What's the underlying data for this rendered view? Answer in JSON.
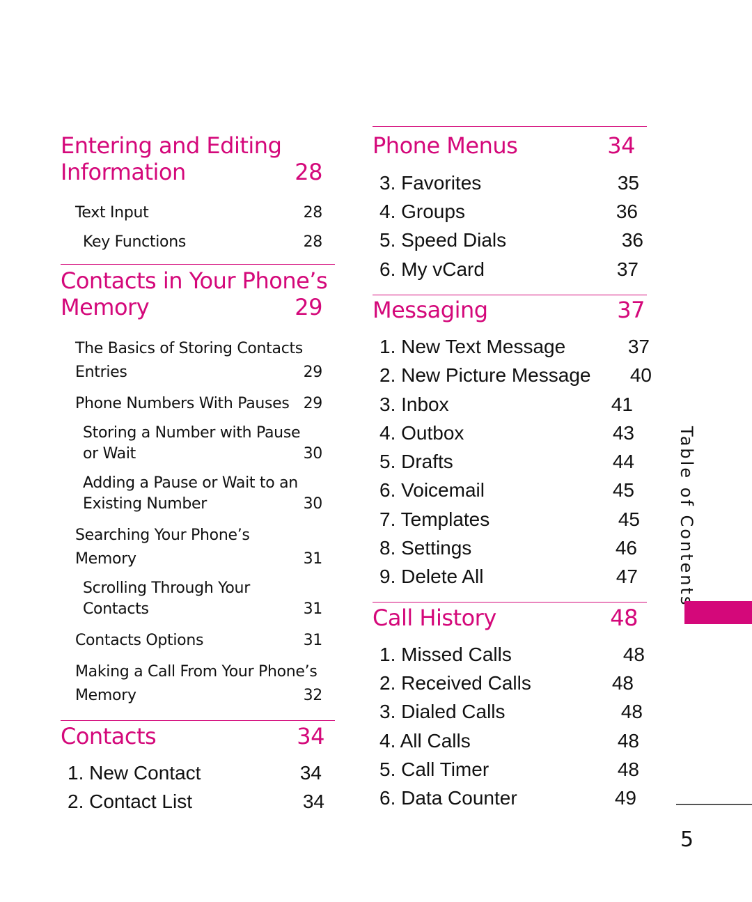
{
  "left_column": {
    "sections": [
      {
        "title_line1": "Entering and Editing",
        "title_line2": "Information",
        "page": "28",
        "entries": [
          {
            "text": "Text Input",
            "page": "28"
          },
          {
            "text": "Key Functions",
            "page": "28"
          }
        ]
      },
      {
        "title_line1": "Contacts in Your Phone’s",
        "title_line2": "Memory",
        "page": "29",
        "entries": [
          {
            "line1": "The Basics of Storing Contacts",
            "line2": "Entries",
            "page": "29"
          },
          {
            "text": "Phone Numbers With Pauses",
            "page": "29"
          },
          {
            "line1": "Storing a Number with Pause",
            "line2": "or Wait",
            "page": "30"
          },
          {
            "line1": "Adding a Pause or Wait to an",
            "line2": "Existing Number",
            "page": "30"
          },
          {
            "line1": "Searching Your Phone’s",
            "line2": "Memory",
            "page": "31"
          },
          {
            "line1": "Scrolling Through Your",
            "line2": "Contacts",
            "page": "31"
          },
          {
            "text": "Contacts Options",
            "page": "31"
          },
          {
            "line1": "Making a Call From Your Phone’s",
            "line2": "Memory",
            "page": "32"
          }
        ]
      },
      {
        "title": "Contacts",
        "page": "34",
        "entries": [
          {
            "text": "1. New Contact",
            "page": "34"
          },
          {
            "text": "2. Contact List",
            "page": "34"
          }
        ]
      }
    ]
  },
  "right_column": {
    "sections": [
      {
        "title": "Phone Menus",
        "page": "34",
        "entries": [
          {
            "text": "3. Favorites",
            "page": "35"
          },
          {
            "text": "4. Groups",
            "page": "36"
          },
          {
            "text": "5. Speed Dials",
            "page": "36"
          },
          {
            "text": "6. My vCard",
            "page": "37"
          }
        ]
      },
      {
        "title": "Messaging",
        "page": "37",
        "entries": [
          {
            "text": "1. New Text Message",
            "page": "37"
          },
          {
            "text": "2. New Picture Message",
            "page": "40"
          },
          {
            "text": "3. Inbox",
            "page": "41"
          },
          {
            "text": "4. Outbox",
            "page": "43"
          },
          {
            "text": "5. Drafts",
            "page": "44"
          },
          {
            "text": "6. Voicemail",
            "page": "45"
          },
          {
            "text": "7. Templates",
            "page": "45"
          },
          {
            "text": "8. Settings",
            "page": "46"
          },
          {
            "text": "9. Delete All",
            "page": "47"
          }
        ]
      },
      {
        "title": "Call History",
        "page": "48",
        "entries": [
          {
            "text": "1. Missed Calls",
            "page": "48"
          },
          {
            "text": "2. Received Calls",
            "page": "48"
          },
          {
            "text": "3. Dialed Calls",
            "page": "48"
          },
          {
            "text": "4. All Calls",
            "page": "48"
          },
          {
            "text": "5. Call Timer",
            "page": "48"
          },
          {
            "text": "6. Data Counter",
            "page": "49"
          }
        ]
      }
    ]
  },
  "sidebar": {
    "label": "Table of Contents",
    "accent_color": "#d4087a"
  },
  "page_number": "5"
}
